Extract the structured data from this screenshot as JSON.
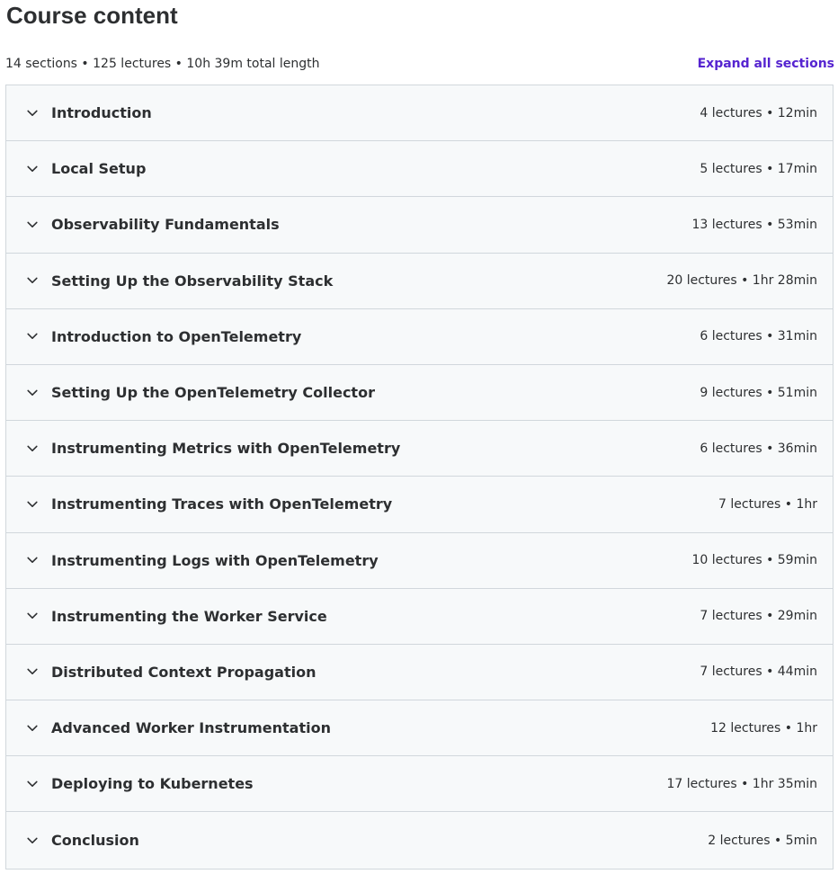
{
  "header": {
    "title": "Course content",
    "summary": "14 sections • 125 lectures • 10h 39m total length",
    "expand_all_label": "Expand all sections"
  },
  "colors": {
    "accent": "#5624d0",
    "text": "#2d2f31",
    "row_bg": "#f7f9fa",
    "border": "#d1d7dc"
  },
  "icons": {
    "section_toggle": "chevron-down-icon"
  },
  "sections": [
    {
      "title": "Introduction",
      "meta": "4 lectures • 12min"
    },
    {
      "title": "Local Setup",
      "meta": "5 lectures • 17min"
    },
    {
      "title": "Observability Fundamentals",
      "meta": "13 lectures • 53min"
    },
    {
      "title": "Setting Up the Observability Stack",
      "meta": "20 lectures • 1hr 28min"
    },
    {
      "title": "Introduction to OpenTelemetry",
      "meta": "6 lectures • 31min"
    },
    {
      "title": "Setting Up the OpenTelemetry Collector",
      "meta": "9 lectures • 51min"
    },
    {
      "title": "Instrumenting Metrics with OpenTelemetry",
      "meta": "6 lectures • 36min"
    },
    {
      "title": "Instrumenting Traces with OpenTelemetry",
      "meta": "7 lectures • 1hr"
    },
    {
      "title": "Instrumenting Logs with OpenTelemetry",
      "meta": "10 lectures • 59min"
    },
    {
      "title": "Instrumenting the Worker Service",
      "meta": "7 lectures • 29min"
    },
    {
      "title": "Distributed Context Propagation",
      "meta": "7 lectures • 44min"
    },
    {
      "title": "Advanced Worker Instrumentation",
      "meta": "12 lectures • 1hr"
    },
    {
      "title": "Deploying to Kubernetes",
      "meta": "17 lectures • 1hr 35min"
    },
    {
      "title": "Conclusion",
      "meta": "2 lectures • 5min"
    }
  ]
}
